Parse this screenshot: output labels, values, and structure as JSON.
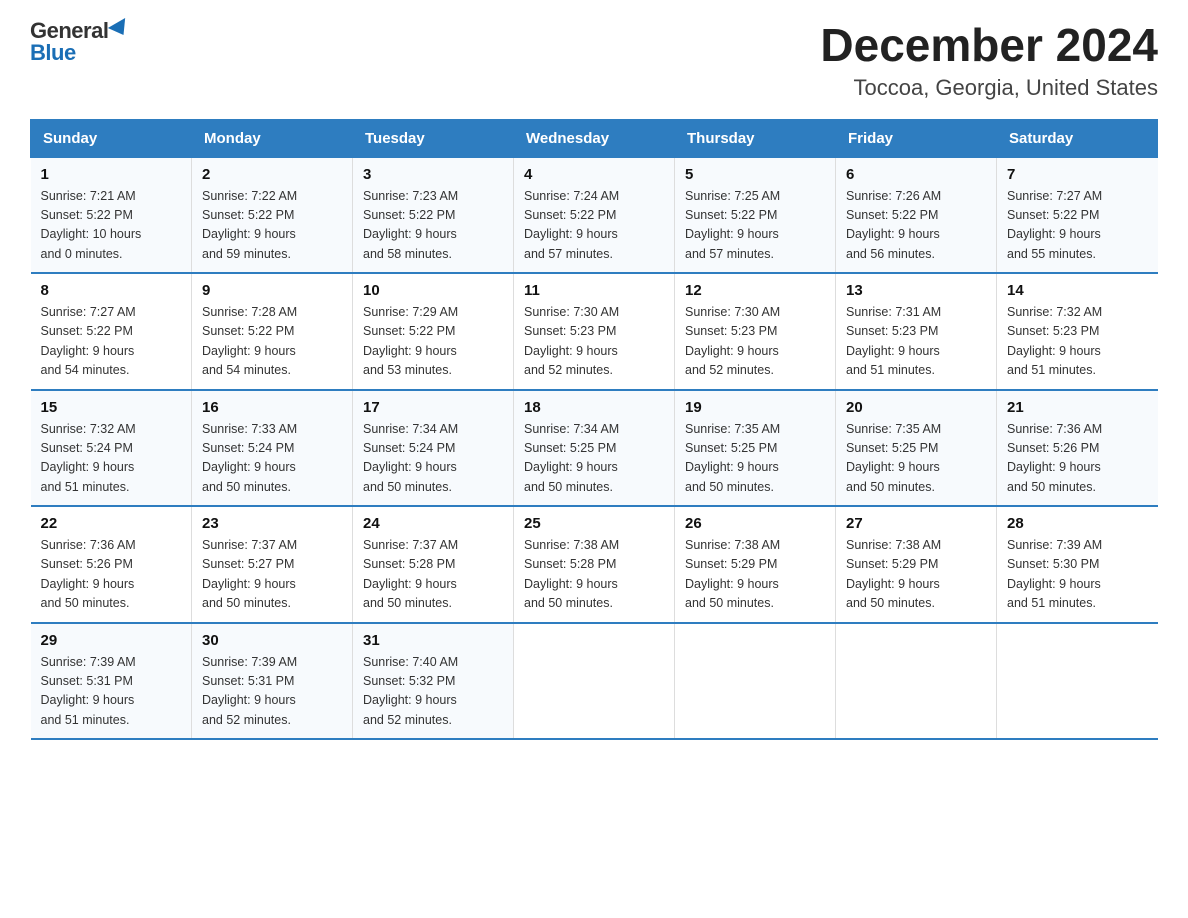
{
  "logo": {
    "general": "General",
    "blue": "Blue"
  },
  "title": "December 2024",
  "subtitle": "Toccoa, Georgia, United States",
  "weekdays": [
    "Sunday",
    "Monday",
    "Tuesday",
    "Wednesday",
    "Thursday",
    "Friday",
    "Saturday"
  ],
  "weeks": [
    [
      {
        "day": "1",
        "sunrise": "7:21 AM",
        "sunset": "5:22 PM",
        "daylight": "10 hours and 0 minutes."
      },
      {
        "day": "2",
        "sunrise": "7:22 AM",
        "sunset": "5:22 PM",
        "daylight": "9 hours and 59 minutes."
      },
      {
        "day": "3",
        "sunrise": "7:23 AM",
        "sunset": "5:22 PM",
        "daylight": "9 hours and 58 minutes."
      },
      {
        "day": "4",
        "sunrise": "7:24 AM",
        "sunset": "5:22 PM",
        "daylight": "9 hours and 57 minutes."
      },
      {
        "day": "5",
        "sunrise": "7:25 AM",
        "sunset": "5:22 PM",
        "daylight": "9 hours and 57 minutes."
      },
      {
        "day": "6",
        "sunrise": "7:26 AM",
        "sunset": "5:22 PM",
        "daylight": "9 hours and 56 minutes."
      },
      {
        "day": "7",
        "sunrise": "7:27 AM",
        "sunset": "5:22 PM",
        "daylight": "9 hours and 55 minutes."
      }
    ],
    [
      {
        "day": "8",
        "sunrise": "7:27 AM",
        "sunset": "5:22 PM",
        "daylight": "9 hours and 54 minutes."
      },
      {
        "day": "9",
        "sunrise": "7:28 AM",
        "sunset": "5:22 PM",
        "daylight": "9 hours and 54 minutes."
      },
      {
        "day": "10",
        "sunrise": "7:29 AM",
        "sunset": "5:22 PM",
        "daylight": "9 hours and 53 minutes."
      },
      {
        "day": "11",
        "sunrise": "7:30 AM",
        "sunset": "5:23 PM",
        "daylight": "9 hours and 52 minutes."
      },
      {
        "day": "12",
        "sunrise": "7:30 AM",
        "sunset": "5:23 PM",
        "daylight": "9 hours and 52 minutes."
      },
      {
        "day": "13",
        "sunrise": "7:31 AM",
        "sunset": "5:23 PM",
        "daylight": "9 hours and 51 minutes."
      },
      {
        "day": "14",
        "sunrise": "7:32 AM",
        "sunset": "5:23 PM",
        "daylight": "9 hours and 51 minutes."
      }
    ],
    [
      {
        "day": "15",
        "sunrise": "7:32 AM",
        "sunset": "5:24 PM",
        "daylight": "9 hours and 51 minutes."
      },
      {
        "day": "16",
        "sunrise": "7:33 AM",
        "sunset": "5:24 PM",
        "daylight": "9 hours and 50 minutes."
      },
      {
        "day": "17",
        "sunrise": "7:34 AM",
        "sunset": "5:24 PM",
        "daylight": "9 hours and 50 minutes."
      },
      {
        "day": "18",
        "sunrise": "7:34 AM",
        "sunset": "5:25 PM",
        "daylight": "9 hours and 50 minutes."
      },
      {
        "day": "19",
        "sunrise": "7:35 AM",
        "sunset": "5:25 PM",
        "daylight": "9 hours and 50 minutes."
      },
      {
        "day": "20",
        "sunrise": "7:35 AM",
        "sunset": "5:25 PM",
        "daylight": "9 hours and 50 minutes."
      },
      {
        "day": "21",
        "sunrise": "7:36 AM",
        "sunset": "5:26 PM",
        "daylight": "9 hours and 50 minutes."
      }
    ],
    [
      {
        "day": "22",
        "sunrise": "7:36 AM",
        "sunset": "5:26 PM",
        "daylight": "9 hours and 50 minutes."
      },
      {
        "day": "23",
        "sunrise": "7:37 AM",
        "sunset": "5:27 PM",
        "daylight": "9 hours and 50 minutes."
      },
      {
        "day": "24",
        "sunrise": "7:37 AM",
        "sunset": "5:28 PM",
        "daylight": "9 hours and 50 minutes."
      },
      {
        "day": "25",
        "sunrise": "7:38 AM",
        "sunset": "5:28 PM",
        "daylight": "9 hours and 50 minutes."
      },
      {
        "day": "26",
        "sunrise": "7:38 AM",
        "sunset": "5:29 PM",
        "daylight": "9 hours and 50 minutes."
      },
      {
        "day": "27",
        "sunrise": "7:38 AM",
        "sunset": "5:29 PM",
        "daylight": "9 hours and 50 minutes."
      },
      {
        "day": "28",
        "sunrise": "7:39 AM",
        "sunset": "5:30 PM",
        "daylight": "9 hours and 51 minutes."
      }
    ],
    [
      {
        "day": "29",
        "sunrise": "7:39 AM",
        "sunset": "5:31 PM",
        "daylight": "9 hours and 51 minutes."
      },
      {
        "day": "30",
        "sunrise": "7:39 AM",
        "sunset": "5:31 PM",
        "daylight": "9 hours and 52 minutes."
      },
      {
        "day": "31",
        "sunrise": "7:40 AM",
        "sunset": "5:32 PM",
        "daylight": "9 hours and 52 minutes."
      },
      null,
      null,
      null,
      null
    ]
  ],
  "labels": {
    "sunrise": "Sunrise:",
    "sunset": "Sunset:",
    "daylight": "Daylight:"
  }
}
